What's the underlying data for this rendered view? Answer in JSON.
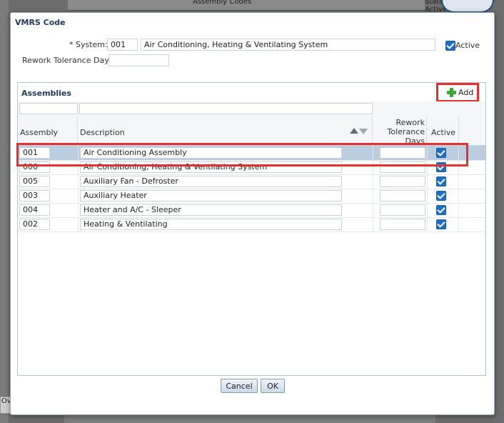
{
  "background": {
    "strip_text": "Assembly Codes",
    "status_text": "Status: Active",
    "bottom_left_text": "Ov"
  },
  "dialog": {
    "title": "VMRS Code",
    "system_label": "* System:",
    "system_code": "001",
    "system_description": "Air Conditioning, Heating & Ventilating System",
    "active_label": "Active",
    "rework_label": "Rework Tolerance Days:",
    "rework_value": ""
  },
  "assemblies": {
    "title": "Assemblies",
    "add_label": "Add",
    "columns": {
      "assembly": "Assembly",
      "description": "Description",
      "rework": [
        "Rework",
        "Tolerance",
        "Days"
      ],
      "active": "Active"
    },
    "rows": [
      {
        "code": "001",
        "description": "Air Conditioning Assembly",
        "active": true,
        "selected": true
      },
      {
        "code": "000",
        "description": "Air Conditioning, Heating & Ventilating System",
        "active": true,
        "selected": false
      },
      {
        "code": "005",
        "description": "Auxiliary Fan - Defroster",
        "active": true,
        "selected": false
      },
      {
        "code": "003",
        "description": "Auxiliary Heater",
        "active": true,
        "selected": false
      },
      {
        "code": "004",
        "description": "Heater and A/C - Sleeper",
        "active": true,
        "selected": false
      },
      {
        "code": "002",
        "description": "Heating & Ventilating",
        "active": true,
        "selected": false
      }
    ]
  },
  "buttons": {
    "cancel": "Cancel",
    "ok": "OK"
  },
  "colors": {
    "highlight": "#e53030",
    "selected_row": "#bccde0",
    "title": "#1d3a5f",
    "checkbox": "#1f6fc4"
  }
}
